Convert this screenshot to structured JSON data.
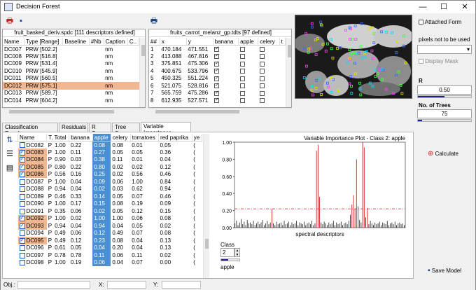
{
  "window": {
    "title": "Decision Forest"
  },
  "left_table": {
    "title": "fruit_basked_deriv.spdc  [111 descriptors defined]",
    "columns": [
      "Name",
      "Type [Range]",
      "Baseline",
      "#Nb",
      "Caption",
      "C.."
    ],
    "rows": [
      {
        "name": "DC007",
        "type": "PRW [502.2]",
        "baseline": "",
        "nb": "",
        "caption": "nm",
        "selected": false
      },
      {
        "name": "DC008",
        "type": "PRW [516.8]",
        "baseline": "",
        "nb": "",
        "caption": "nm",
        "selected": false
      },
      {
        "name": "DC009",
        "type": "PRW [531.4]",
        "baseline": "",
        "nb": "",
        "caption": "nm",
        "selected": false
      },
      {
        "name": "DC010",
        "type": "PRW [545.9]",
        "baseline": "",
        "nb": "",
        "caption": "nm",
        "selected": false
      },
      {
        "name": "DC011",
        "type": "PRW [560.5]",
        "baseline": "",
        "nb": "",
        "caption": "nm",
        "selected": false
      },
      {
        "name": "DC012",
        "type": "PRW [575.1]",
        "baseline": "",
        "nb": "",
        "caption": "nm",
        "selected": true
      },
      {
        "name": "DC013",
        "type": "PRW [589.7]",
        "baseline": "",
        "nb": "",
        "caption": "nm",
        "selected": false
      },
      {
        "name": "DC014",
        "type": "PRW [604.2]",
        "baseline": "",
        "nb": "",
        "caption": "nm",
        "selected": false
      }
    ]
  },
  "right_table": {
    "title": "fruits_carrot_melanz_gp.tdts [97 defined]",
    "columns": [
      "##",
      "x",
      "y",
      "banana",
      "apple",
      "celery",
      "t"
    ],
    "rows": [
      {
        "n": "1",
        "x": "470.184",
        "y": "471.551",
        "banana": true,
        "apple": false,
        "celery": false
      },
      {
        "n": "2",
        "x": "413.088",
        "y": "467.816",
        "banana": true,
        "apple": false,
        "celery": false
      },
      {
        "n": "3",
        "x": "375.851",
        "y": "475.306",
        "banana": true,
        "apple": false,
        "celery": false
      },
      {
        "n": "4",
        "x": "400.675",
        "y": "533.796",
        "banana": true,
        "apple": false,
        "celery": false
      },
      {
        "n": "5",
        "x": "450.325",
        "y": "551.224",
        "banana": true,
        "apple": false,
        "celery": false
      },
      {
        "n": "6",
        "x": "521.075",
        "y": "528.816",
        "banana": true,
        "apple": false,
        "celery": false
      },
      {
        "n": "7",
        "x": "565.759",
        "y": "475.286",
        "banana": true,
        "apple": false,
        "celery": false
      },
      {
        "n": "8",
        "x": "612.935",
        "y": "527.571",
        "banana": true,
        "apple": false,
        "celery": false
      }
    ]
  },
  "controls": {
    "attached_form": "Attached Form",
    "pixels_label": "pixels not to be used",
    "display_mask": "Display Mask",
    "r_label": "R",
    "r_value": "0.50",
    "r_level": 0.5,
    "trees_label": "No. of Trees",
    "trees_value": "75",
    "trees_level": 0.08,
    "calculate": "Calculate",
    "save_model": "Save Model"
  },
  "tabs": [
    "Classification Results",
    "Residuals",
    "R Scan",
    "Tree Scan",
    "Variable Importance"
  ],
  "active_tab": "Variable Importance",
  "vi_table": {
    "columns": [
      "Name",
      "T. Total",
      "banana",
      "apple",
      "celery",
      "tomatoes",
      "red paprika",
      "ye"
    ],
    "rows": [
      {
        "name": "DC082",
        "t": "P",
        "total": "1.00",
        "banana": "0.22",
        "apple": "0.08",
        "celery": "0.08",
        "tomatoes": "0.01",
        "paprika": "0.05",
        "ye": "(",
        "checked": false,
        "hl": false
      },
      {
        "name": "DC083",
        "t": "P",
        "total": "1.00",
        "banana": "0.11",
        "apple": "0.27",
        "celery": "0.05",
        "tomatoes": "0.05",
        "paprika": "0.36",
        "ye": "(",
        "checked": true,
        "hl": true
      },
      {
        "name": "DC084",
        "t": "P",
        "total": "0.90",
        "banana": "0.03",
        "apple": "0.38",
        "celery": "0.11",
        "tomatoes": "0.01",
        "paprika": "0.04",
        "ye": "(",
        "checked": true,
        "hl": true
      },
      {
        "name": "DC085",
        "t": "P",
        "total": "0.80",
        "banana": "0.22",
        "apple": "0.80",
        "celery": "0.02",
        "tomatoes": "0.02",
        "paprika": "0.12",
        "ye": "(",
        "checked": true,
        "hl": true
      },
      {
        "name": "DC086",
        "t": "P",
        "total": "0.56",
        "banana": "0.16",
        "apple": "0.25",
        "celery": "0.02",
        "tomatoes": "0.56",
        "paprika": "0.46",
        "ye": "(",
        "checked": true,
        "hl": true
      },
      {
        "name": "DC087",
        "t": "P",
        "total": "1.00",
        "banana": "0.04",
        "apple": "0.09",
        "celery": "0.06",
        "tomatoes": "1.00",
        "paprika": "0.84",
        "ye": "(",
        "checked": false,
        "hl": false
      },
      {
        "name": "DC088",
        "t": "P",
        "total": "0.94",
        "banana": "0.04",
        "apple": "0.02",
        "celery": "0.03",
        "tomatoes": "0.62",
        "paprika": "0.94",
        "ye": "(",
        "checked": false,
        "hl": false
      },
      {
        "name": "DC089",
        "t": "P",
        "total": "0.46",
        "banana": "0.33",
        "apple": "0.14",
        "celery": "0.05",
        "tomatoes": "0.07",
        "paprika": "0.46",
        "ye": "(",
        "checked": false,
        "hl": false
      },
      {
        "name": "DC090",
        "t": "P",
        "total": "1.00",
        "banana": "0.17",
        "apple": "0.15",
        "celery": "0.08",
        "tomatoes": "0.19",
        "paprika": "0.09",
        "ye": "(",
        "checked": false,
        "hl": false
      },
      {
        "name": "DC091",
        "t": "P",
        "total": "0.35",
        "banana": "0.06",
        "apple": "0.02",
        "celery": "0.05",
        "tomatoes": "0.12",
        "paprika": "0.15",
        "ye": "(",
        "checked": false,
        "hl": false
      },
      {
        "name": "DC092",
        "t": "P",
        "total": "1.00",
        "banana": "0.02",
        "apple": "1.00",
        "celery": "1.00",
        "tomatoes": "0.06",
        "paprika": "0.08",
        "ye": "(",
        "checked": true,
        "hl": true
      },
      {
        "name": "DC093",
        "t": "P",
        "total": "0.94",
        "banana": "0.04",
        "apple": "0.94",
        "celery": "0.04",
        "tomatoes": "0.05",
        "paprika": "0.02",
        "ye": "(",
        "checked": true,
        "hl": true
      },
      {
        "name": "DC094",
        "t": "P",
        "total": "0.49",
        "banana": "0.06",
        "apple": "0.12",
        "celery": "0.49",
        "tomatoes": "0.07",
        "paprika": "0.08",
        "ye": "(",
        "checked": false,
        "hl": false
      },
      {
        "name": "DC095",
        "t": "P",
        "total": "0.49",
        "banana": "0.12",
        "apple": "0.23",
        "celery": "0.08",
        "tomatoes": "0.04",
        "paprika": "0.13",
        "ye": "(",
        "checked": true,
        "hl": true
      },
      {
        "name": "DC096",
        "t": "P",
        "total": "0.61",
        "banana": "0.05",
        "apple": "0.04",
        "celery": "0.20",
        "tomatoes": "0.04",
        "paprika": "0.13",
        "ye": "(",
        "checked": false,
        "hl": false
      },
      {
        "name": "DC097",
        "t": "P",
        "total": "0.78",
        "banana": "0.78",
        "apple": "0.11",
        "celery": "0.06",
        "tomatoes": "0.11",
        "paprika": "0.02",
        "ye": "(",
        "checked": false,
        "hl": false
      },
      {
        "name": "DC098",
        "t": "P",
        "total": "1.00",
        "banana": "0.19",
        "apple": "0.06",
        "celery": "0.04",
        "tomatoes": "0.07",
        "paprika": "0.00",
        "ye": "(",
        "checked": false,
        "hl": false
      }
    ]
  },
  "chart_data": {
    "type": "bar",
    "title": "Variable Importance Plot - Class 2: apple",
    "xlabel": "spectral descriptors",
    "ylabel": "",
    "ylim": [
      0,
      1.0
    ],
    "yticks": [
      "0.00",
      "0.20",
      "0.40",
      "0.60",
      "0.80",
      "1.00"
    ],
    "threshold": 0.22,
    "values": [
      0.05,
      0.08,
      0.03,
      0.06,
      0.1,
      0.04,
      0.07,
      0.03,
      0.09,
      0.05,
      0.06,
      0.04,
      0.08,
      0.03,
      0.05,
      0.07,
      0.04,
      0.06,
      0.09,
      0.03,
      0.05,
      0.08,
      0.04,
      0.06,
      0.22,
      0.05,
      0.03,
      0.07,
      0.04,
      0.05,
      0.06,
      0.03,
      0.08,
      0.04,
      0.05,
      0.07,
      0.03,
      0.06,
      0.04,
      0.05,
      0.08,
      0.03,
      0.06,
      0.05,
      0.04,
      0.07,
      0.03,
      0.05,
      0.06,
      0.04,
      0.08,
      0.03,
      0.05,
      0.9,
      0.97,
      0.36,
      0.06,
      0.04,
      0.07,
      0.05,
      0.03,
      0.06,
      0.04,
      0.05,
      0.08,
      0.03,
      0.06,
      0.04,
      0.05,
      0.07,
      0.03,
      0.05,
      0.06,
      0.04,
      0.08,
      0.15,
      0.27,
      0.38,
      0.22,
      0.8,
      0.25,
      0.09,
      0.06,
      1.0,
      0.94,
      0.12,
      0.23,
      0.04,
      0.08,
      0.05,
      0.03,
      0.06,
      0.04,
      0.05,
      0.07,
      0.03,
      0.06,
      0.05,
      0.04,
      0.08,
      0.03,
      0.05,
      0.06,
      0.04,
      0.07,
      0.03,
      0.05,
      0.06,
      0.04,
      0.05,
      0.03
    ]
  },
  "class_control": {
    "label": "Class",
    "value": "2",
    "name": "apple"
  },
  "status": {
    "obj_label": "Obj.:",
    "x_label": "X:",
    "y_label": "Y:"
  }
}
